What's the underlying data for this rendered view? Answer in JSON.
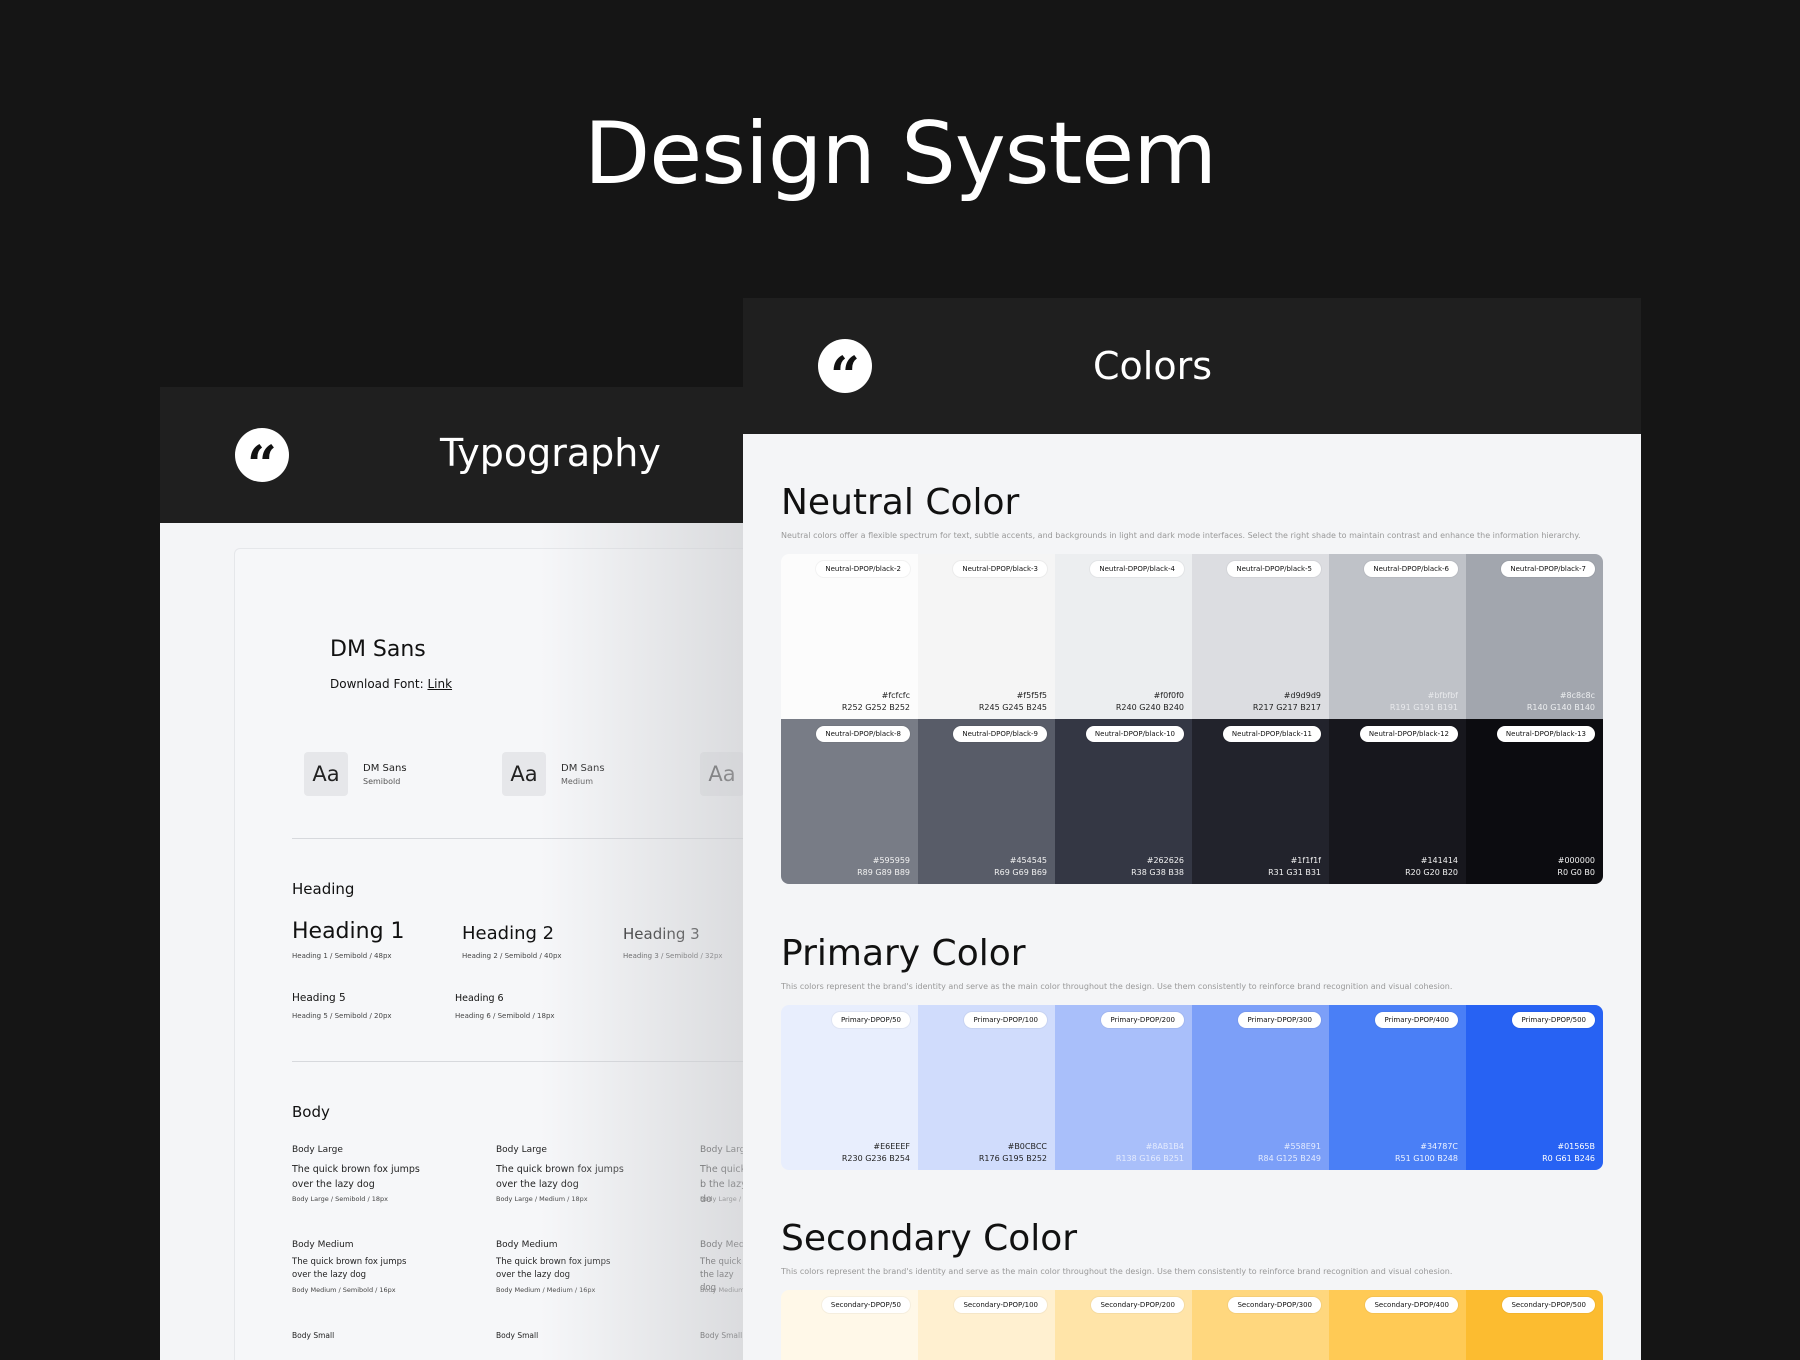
{
  "page_title": "Design System",
  "typography": {
    "title": "Typography",
    "logo_glyph": "“",
    "font_name": "DM Sans",
    "download_label": "Download Font:",
    "download_link": "Link",
    "samples": [
      {
        "aa": "Aa",
        "name": "DM Sans",
        "weight": "Semibold"
      },
      {
        "aa": "Aa",
        "name": "DM Sans",
        "weight": "Medium"
      },
      {
        "aa": "Aa"
      }
    ],
    "heading_section": "Heading",
    "headings": [
      {
        "text": "Heading 1",
        "note": "Heading 1 / Semibold / 48px"
      },
      {
        "text": "Heading 2",
        "note": "Heading 2 / Semibold / 40px"
      },
      {
        "text": "Heading 3",
        "note": "Heading 3 / Semibold / 32px"
      },
      {
        "text": "Heading 5",
        "note": "Heading 5 / Semibold / 20px"
      },
      {
        "text": "Heading 6",
        "note": "Heading 6 / Semibold / 18px"
      }
    ],
    "body_section": "Body",
    "body_large": [
      {
        "title": "Body Large",
        "text": "The quick brown fox jumps over the lazy dog",
        "note": "Body Large / Semibold / 18px"
      },
      {
        "title": "Body Large",
        "text": "The quick brown fox jumps over the lazy dog",
        "note": "Body Large / Medium / 18px"
      },
      {
        "title": "Body Large",
        "text": "The quick b the lazy do",
        "note": "Body Large /"
      }
    ],
    "body_medium": [
      {
        "title": "Body Medium",
        "text": "The quick brown fox jumps over the lazy dog",
        "note": "Body Medium / Semibold / 16px"
      },
      {
        "title": "Body Medium",
        "text": "The quick brown fox jumps over the lazy dog",
        "note": "Body Medium / Medium / 16px"
      },
      {
        "title": "Body Mediu",
        "text": "The quick b the lazy dog",
        "note": "Body Medium"
      }
    ],
    "body_small": [
      "Body Small",
      "Body Small",
      "Body Small"
    ]
  },
  "colors_card": {
    "title": "Colors",
    "logo_glyph": "“",
    "neutral": {
      "title": "Neutral Color",
      "description": "Neutral colors offer a flexible spectrum for text, subtle accents, and backgrounds in light and dark mode interfaces. Select the right shade to maintain contrast and enhance the information hierarchy.",
      "row1": [
        {
          "name": "Neutral-DPOP/black-2",
          "hex": "#fcfcfc",
          "rgb": "R252 G252 B252",
          "color": "#fcfcfc",
          "text_color": "#222222"
        },
        {
          "name": "Neutral-DPOP/black-3",
          "hex": "#f5f5f5",
          "rgb": "R245 G245 B245",
          "color": "#f5f5f5",
          "text_color": "#222222"
        },
        {
          "name": "Neutral-DPOP/black-4",
          "hex": "#f0f0f0",
          "rgb": "R240 G240 B240",
          "color": "#eceef0",
          "text_color": "#222222"
        },
        {
          "name": "Neutral-DPOP/black-5",
          "hex": "#d9d9d9",
          "rgb": "R217 G217 B217",
          "color": "#dcdde1",
          "text_color": "#222222"
        },
        {
          "name": "Neutral-DPOP/black-6",
          "hex": "#bfbfbf",
          "rgb": "R191 G191 B191",
          "color": "#bfc2c8",
          "text_color": "#e8e9ec"
        },
        {
          "name": "Neutral-DPOP/black-7",
          "hex": "#8c8c8c",
          "rgb": "R140 G140 B140",
          "color": "#a2a6ae",
          "text_color": "#eceef0"
        }
      ],
      "row2": [
        {
          "name": "Neutral-DPOP/black-8",
          "hex": "#595959",
          "rgb": "R89 G89 B89",
          "color": "#787c86",
          "text_color": "#f1f1f1"
        },
        {
          "name": "Neutral-DPOP/black-9",
          "hex": "#454545",
          "rgb": "R69 G69 B69",
          "color": "#585c68",
          "text_color": "#f1f1f1"
        },
        {
          "name": "Neutral-DPOP/black-10",
          "hex": "#262626",
          "rgb": "R38 G38 B38",
          "color": "#343744",
          "text_color": "#f1f1f1"
        },
        {
          "name": "Neutral-DPOP/black-11",
          "hex": "#1f1f1f",
          "rgb": "R31 G31 B31",
          "color": "#22232c",
          "text_color": "#f1f1f1"
        },
        {
          "name": "Neutral-DPOP/black-12",
          "hex": "#141414",
          "rgb": "R20 G20 B20",
          "color": "#17171d",
          "text_color": "#f1f1f1"
        },
        {
          "name": "Neutral-DPOP/black-13",
          "hex": "#000000",
          "rgb": "R0 G0 B0",
          "color": "#0c0c10",
          "text_color": "#f1f1f1"
        }
      ]
    },
    "primary": {
      "title": "Primary Color",
      "description": "This colors represent the brand's identity and serve as the main color throughout the design. Use them consistently to reinforce brand recognition and visual cohesion.",
      "row": [
        {
          "name": "Primary-DPOP/50",
          "hex": "#E6EEEF",
          "rgb": "R230 G236 B254",
          "color": "#e8eefd",
          "text_color": "#222222"
        },
        {
          "name": "Primary-DPOP/100",
          "hex": "#B0CBCC",
          "rgb": "R176 G195 B252",
          "color": "#d0dcfc",
          "text_color": "#222222"
        },
        {
          "name": "Primary-DPOP/200",
          "hex": "#8AB1B4",
          "rgb": "R138 G166 B251",
          "color": "#a9bffa",
          "text_color": "#e4ebfe"
        },
        {
          "name": "Primary-DPOP/300",
          "hex": "#558E91",
          "rgb": "R84 G125 B249",
          "color": "#7c9ff8",
          "text_color": "#e4ebfe"
        },
        {
          "name": "Primary-DPOP/400",
          "hex": "#34787C",
          "rgb": "R51 G100 B248",
          "color": "#4a7ff6",
          "text_color": "#eef3ff"
        },
        {
          "name": "Primary-DPOP/500",
          "hex": "#01565B",
          "rgb": "R0 G61 B246",
          "color": "#2762f3",
          "text_color": "#ffffff"
        }
      ]
    },
    "secondary": {
      "title": "Secondary Color",
      "description": "This colors represent the brand's identity and serve as the main color throughout the design. Use them consistently to reinforce brand recognition and visual cohesion.",
      "row": [
        {
          "name": "Secondary-DPOP/50",
          "color": "#fff8e8"
        },
        {
          "name": "Secondary-DPOP/100",
          "color": "#fff0d0"
        },
        {
          "name": "Secondary-DPOP/200",
          "color": "#ffe4a8"
        },
        {
          "name": "Secondary-DPOP/300",
          "color": "#ffd77e"
        },
        {
          "name": "Secondary-DPOP/400",
          "color": "#ffca55"
        },
        {
          "name": "Secondary-DPOP/500",
          "color": "#fcbc30"
        }
      ]
    }
  }
}
